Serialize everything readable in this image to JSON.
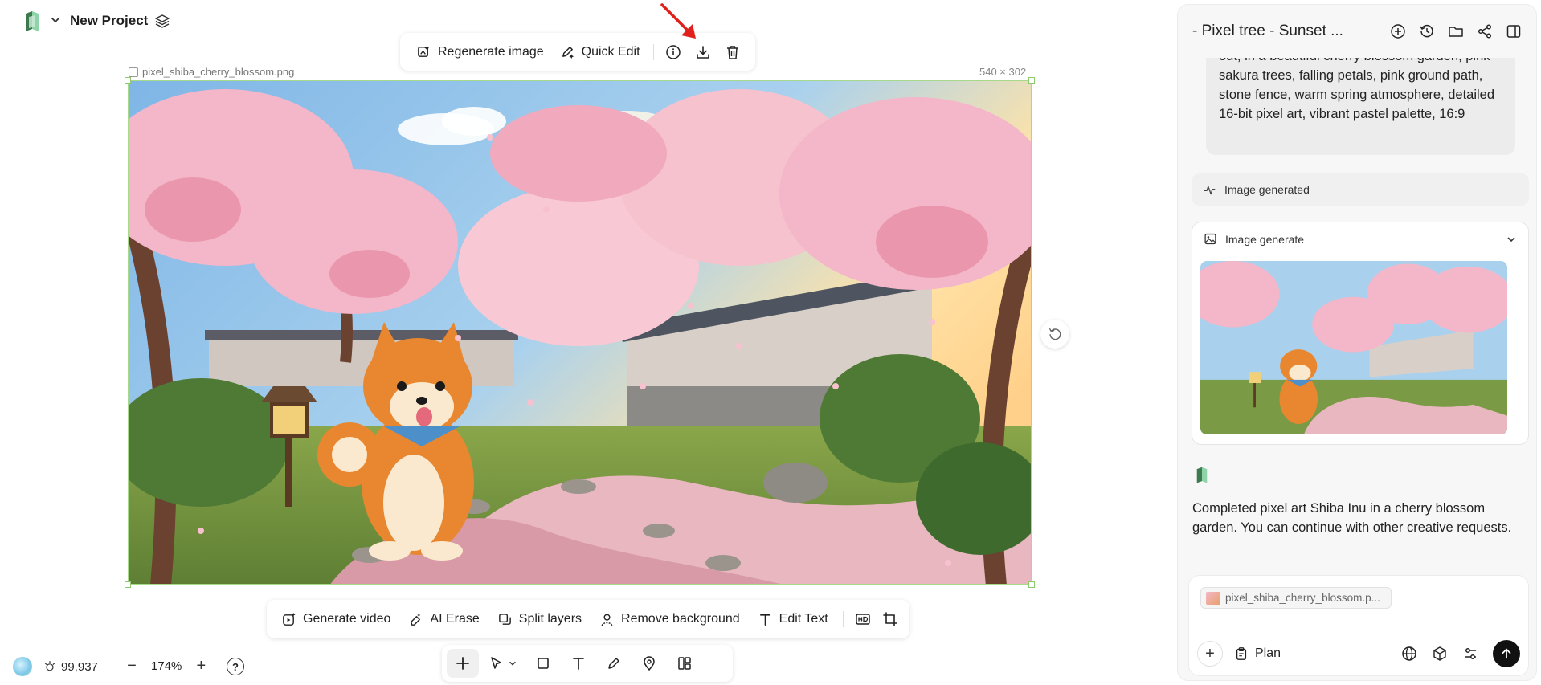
{
  "header": {
    "project_name": "New Project"
  },
  "top_toolbar": {
    "regenerate_label": "Regenerate image",
    "quick_edit_label": "Quick Edit"
  },
  "canvas": {
    "file_name": "pixel_shiba_cherry_blossom.png",
    "dimensions": "540 × 302"
  },
  "bottom_toolbar": {
    "generate_video": "Generate video",
    "ai_erase": "AI Erase",
    "split_layers": "Split layers",
    "remove_background": "Remove background",
    "edit_text": "Edit Text"
  },
  "status": {
    "credits": "99,937",
    "zoom": "174%"
  },
  "panel": {
    "title": "- Pixel tree - Sunset ...",
    "prompt_text": "out, in a beautiful cherry blossom garden, pink sakura trees, falling petals, pink ground path, stone fence, warm spring atmosphere, detailed 16-bit pixel art, vibrant pastel palette, 16:9",
    "image_generated_label": "Image generated",
    "image_generate_card_title": "Image generate",
    "reply_text": "Completed pixel art Shiba Inu in a cherry blossom garden. You can continue with other creative requests.",
    "attachment_name": "pixel_shiba_cherry_blossom.p...",
    "plan_label": "Plan"
  },
  "colors": {
    "accent_green": "#a6d98a",
    "arrow_red": "#e0201b",
    "sakura_pink": "#f4b6c9"
  }
}
